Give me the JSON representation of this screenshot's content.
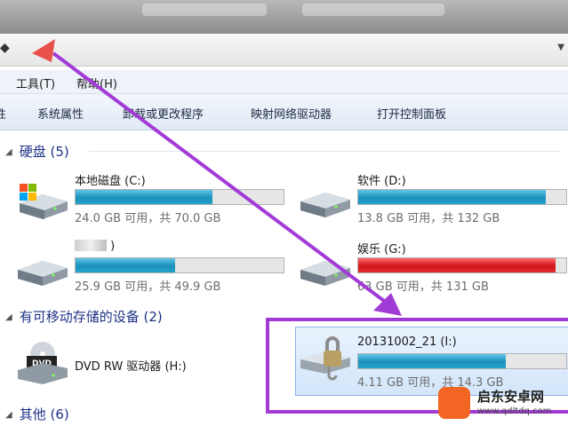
{
  "menu": {
    "tools": "工具(T)",
    "help": "帮助(H)"
  },
  "toolbar": {
    "partial": "性",
    "system_properties": "系统属性",
    "uninstall": "卸载或更改程序",
    "map_drive": "映射网络驱动器",
    "control_panel": "打开控制面板"
  },
  "sections": {
    "hard_disks": "硬盘 (5)",
    "removable": "有可移动存储的设备 (2)",
    "other": "其他 (6)"
  },
  "drives": {
    "c": {
      "name": "本地磁盘 (C:)",
      "usage": "24.0 GB 可用，共 70.0 GB",
      "used_fraction": 0.66
    },
    "d": {
      "name": "软件 (D:)",
      "usage": "13.8 GB 可用，共 132 GB",
      "used_fraction": 0.9
    },
    "e": {
      "name": ")",
      "usage": "25.9 GB 可用，共 49.9 GB",
      "used_fraction": 0.48
    },
    "g": {
      "name": "娱乐 (G:)",
      "usage": "63 GB 可用，共 131 GB",
      "used_fraction": 0.95
    },
    "h": {
      "name": "DVD RW 驱动器 (H:)"
    },
    "i": {
      "name": "20131002_21 (I:)",
      "usage": "4.11 GB 可用，共 14.3 GB",
      "used_fraction": 0.71
    }
  },
  "watermark": {
    "title": "启东安卓网",
    "url": "www.qdltdq.com"
  },
  "icons": {
    "hdd": "hard-drive-icon",
    "windows_hdd": "windows-system-drive-icon",
    "dvd": "dvd-drive-icon",
    "locked_usb": "locked-usb-drive-icon"
  },
  "colors": {
    "bar_blue": "#1a8fb9",
    "bar_red": "#d0151b",
    "annotation": "#a23bd6"
  }
}
